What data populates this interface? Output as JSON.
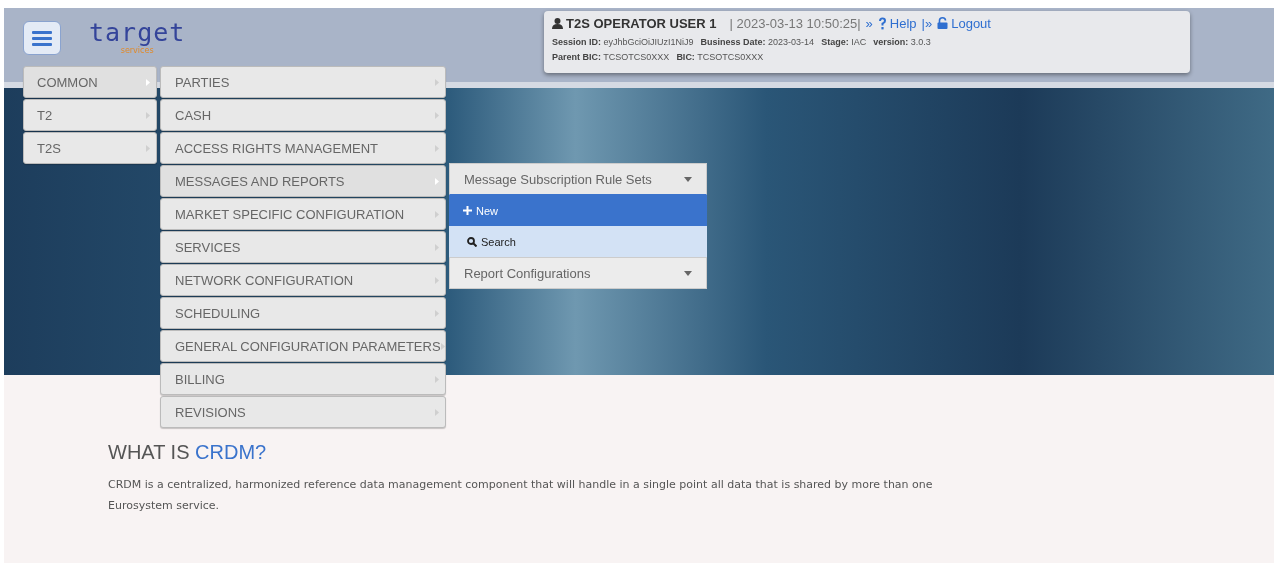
{
  "header": {
    "logo": {
      "name": "target",
      "tagline": "services"
    },
    "user": "T2S OPERATOR USER 1",
    "datetime": "| 2023-03-13 10:50:25|",
    "help_sep": "»",
    "help": "Help",
    "logout_sep": "|»",
    "logout": "Logout",
    "details": [
      [
        {
          "label": "Session ID:",
          "value": "eyJhbGciOiJIUzI1NiJ9"
        },
        {
          "label": "Business Date:",
          "value": "2023-03-14"
        },
        {
          "label": "Stage:",
          "value": "IAC"
        },
        {
          "label": "version:",
          "value": "3.0.3"
        }
      ],
      [
        {
          "label": "Parent BIC:",
          "value": "TCSOTCS0XXX"
        },
        {
          "label": "BIC:",
          "value": "TCSOTCS0XXX"
        }
      ]
    ]
  },
  "menu": {
    "level1": [
      {
        "label": "COMMON",
        "selected": true
      },
      {
        "label": "T2",
        "selected": false
      },
      {
        "label": "T2S",
        "selected": false
      }
    ],
    "level2": [
      {
        "label": "PARTIES",
        "selected": false
      },
      {
        "label": "CASH",
        "selected": false
      },
      {
        "label": "ACCESS RIGHTS MANAGEMENT",
        "selected": false
      },
      {
        "label": "MESSAGES AND REPORTS",
        "selected": true
      },
      {
        "label": "MARKET SPECIFIC CONFIGURATION",
        "selected": false
      },
      {
        "label": "SERVICES",
        "selected": false
      },
      {
        "label": "NETWORK CONFIGURATION",
        "selected": false
      },
      {
        "label": "SCHEDULING",
        "selected": false
      },
      {
        "label": "GENERAL CONFIGURATION PARAMETERS",
        "selected": false
      },
      {
        "label": "BILLING",
        "selected": false
      },
      {
        "label": "REVISIONS",
        "selected": false
      }
    ],
    "level3": [
      {
        "label": "Message Subscription Rule Sets",
        "expanded": true,
        "items": [
          {
            "label": "New",
            "kind": "new",
            "selected": true
          },
          {
            "label": "Search",
            "kind": "search",
            "selected": false
          }
        ]
      },
      {
        "label": "Report Configurations",
        "expanded": false
      }
    ]
  },
  "intro": {
    "title": "WHAT IS ",
    "title_highlight": "CRDM?",
    "text": "CRDM is a centralized, harmonized reference data management component that will handle in a single point all data that is shared by more than one Eurosystem service."
  }
}
